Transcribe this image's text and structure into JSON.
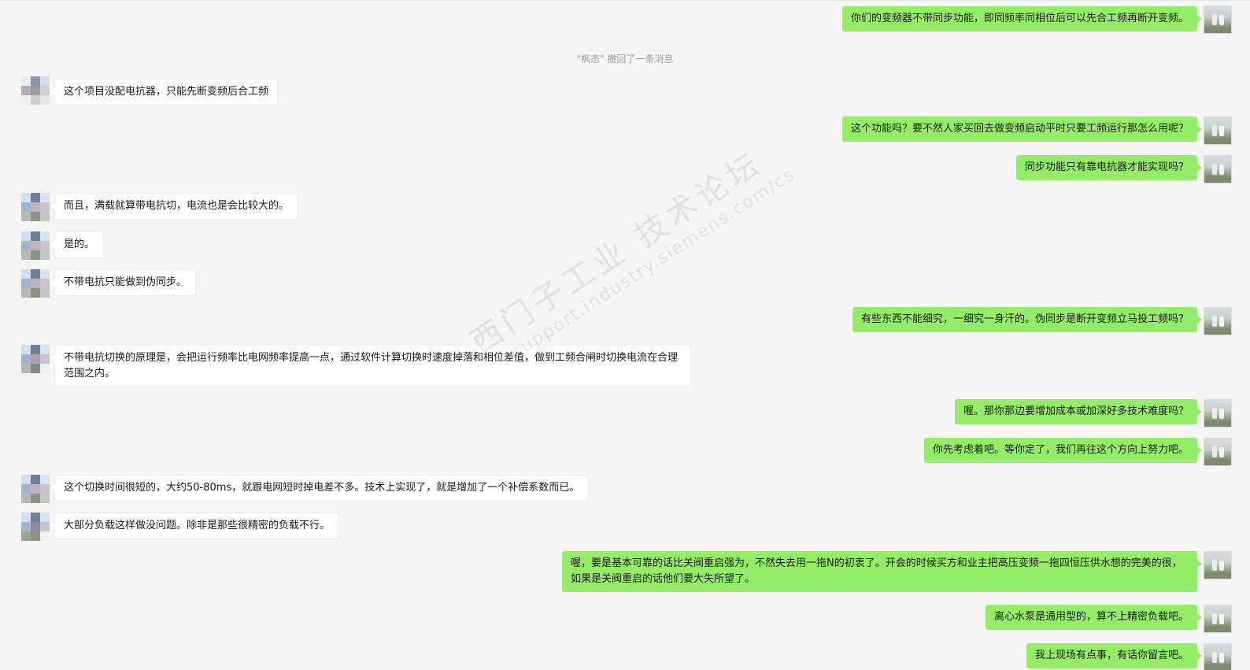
{
  "recall_notice": "\"枫态\" 撤回了一条消息",
  "watermark": {
    "line1": "西门子工业  技术论坛",
    "line2": "support.industry.siemens.com/cs"
  },
  "messages": [
    {
      "side": "right",
      "text": "你们的变频器不带同步功能，即同频率同相位后可以先合工频再断开变频。"
    },
    {
      "side": "left",
      "text": "这个项目没配电抗器，只能先断变频后合工频"
    },
    {
      "side": "right",
      "text": "这个功能吗？要不然人家买回去做变频启动平时只要工频运行那怎么用呢？"
    },
    {
      "side": "right",
      "text": "同步功能只有靠电抗器才能实现吗？"
    },
    {
      "side": "left",
      "text": "而且，满载就算带电抗切，电流也是会比较大的。"
    },
    {
      "side": "left",
      "text": "是的。"
    },
    {
      "side": "left",
      "text": "不带电抗只能做到伪同步。"
    },
    {
      "side": "right",
      "text": "有些东西不能细究，一细究一身汗的。伪同步是断开变频立马投工频吗？"
    },
    {
      "side": "left",
      "text": "不带电抗切换的原理是，会把运行频率比电网频率提高一点，通过软件计算切换时速度掉落和相位差值，做到工频合闸时切换电流在合理范围之内。"
    },
    {
      "side": "right",
      "text": "喔。那你那边要增加成本或加深好多技术难度吗？"
    },
    {
      "side": "right",
      "text": "你先考虑着吧。等你定了，我们再往这个方向上努力吧。"
    },
    {
      "side": "left",
      "text": "这个切换时间很短的，大约50-80ms，就跟电网短时掉电差不多。技术上实现了，就是增加了一个补偿系数而已。"
    },
    {
      "side": "left",
      "text": "大部分负载这样做没问题。除非是那些很精密的负载不行。"
    },
    {
      "side": "right",
      "text": "喔，要是基本可靠的话比关阀重启强为，不然失去用一拖N的初衷了。开会的时候买方和业主把高压变频一拖四恒压供水想的完美的很，如果是关阀重启的话他们要大失所望了。"
    },
    {
      "side": "right",
      "text": "离心水泵是通用型的，算不上精密负载吧。"
    },
    {
      "side": "right",
      "text": "我上现场有点事，有话你留言吧。"
    }
  ],
  "colors": {
    "background": "#f5f5f5",
    "bubble_self": "#95ec69",
    "bubble_other": "#ffffff",
    "recall_text": "#9b9b9b"
  },
  "icons": {
    "left_avatar": "mosaic-avatar-icon",
    "right_avatar": "photo-avatar-icon"
  }
}
